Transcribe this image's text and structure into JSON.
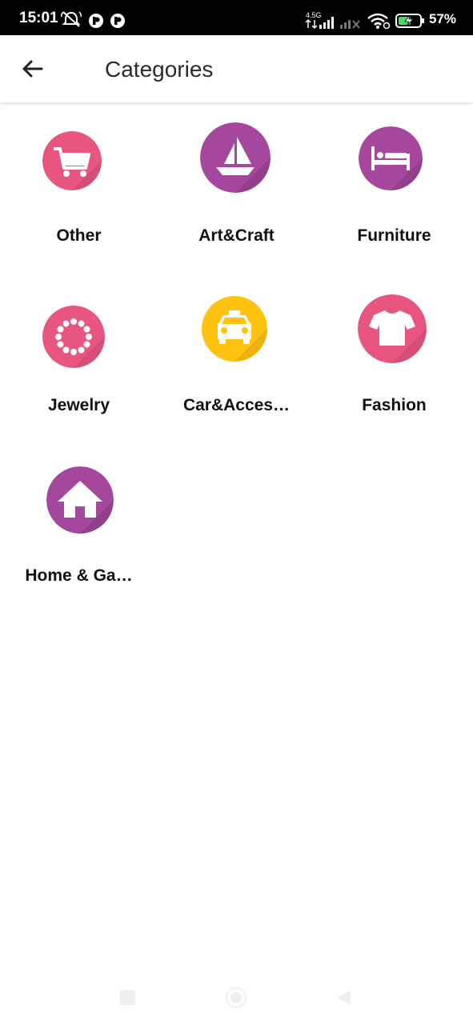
{
  "status_bar": {
    "time": "15:01",
    "network_label": "4.5G",
    "battery": "57%"
  },
  "app_bar": {
    "title": "Categories"
  },
  "categories": [
    {
      "label": "Other",
      "icon": "cart-icon",
      "color": "#E8557F"
    },
    {
      "label": "Art&Craft",
      "icon": "sailboat-icon",
      "color": "#A5479D"
    },
    {
      "label": "Furniture",
      "icon": "bed-icon",
      "color": "#A5479D"
    },
    {
      "label": "Jewelry",
      "icon": "necklace-icon",
      "color": "#E8557F"
    },
    {
      "label": "Car&Acces…",
      "icon": "car-icon",
      "color": "#FFC20E"
    },
    {
      "label": "Fashion",
      "icon": "tshirt-icon",
      "color": "#E8557F"
    },
    {
      "label": "Home & Ga…",
      "icon": "house-icon",
      "color": "#A5479D"
    }
  ]
}
